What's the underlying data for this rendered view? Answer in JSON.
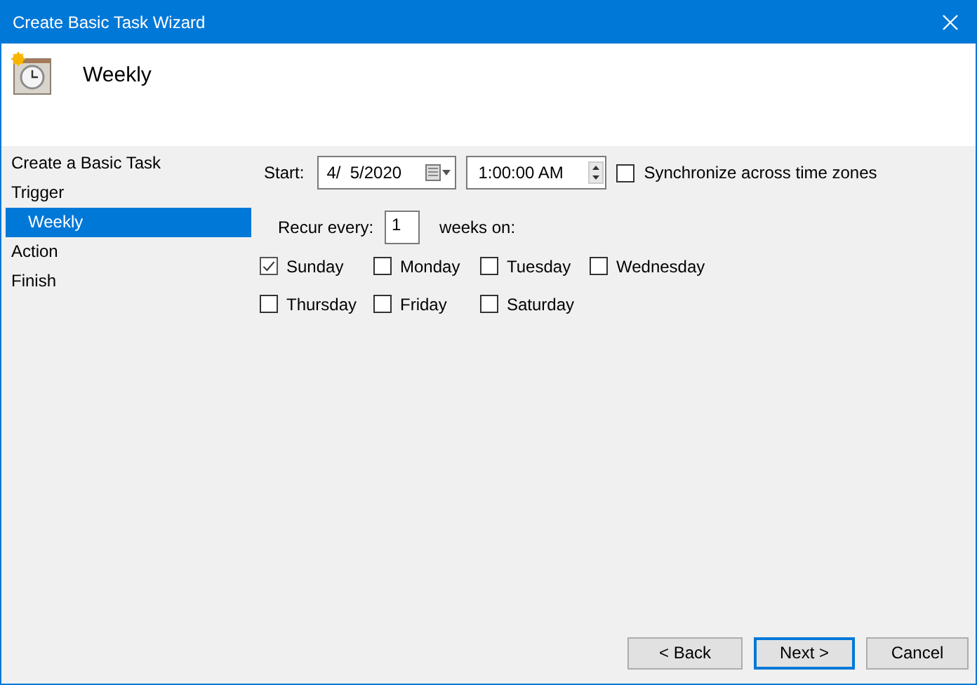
{
  "window": {
    "title": "Create Basic Task Wizard"
  },
  "header": {
    "title": "Weekly"
  },
  "steps": [
    {
      "label": "Create a Basic Task",
      "selected": false
    },
    {
      "label": "Trigger",
      "selected": false,
      "children": [
        {
          "label": "Weekly",
          "selected": true
        }
      ]
    },
    {
      "label": "Action",
      "selected": false
    },
    {
      "label": "Finish",
      "selected": false
    }
  ],
  "schedule": {
    "start_label": "Start:",
    "date": "4/  5/2020",
    "time": "1:00:00 AM",
    "sync": {
      "label": "Synchronize across time zones",
      "checked": false
    },
    "recur_label": "Recur every:",
    "recur_value": "1",
    "recur_suffix": "weeks on:",
    "days": [
      {
        "label": "Sunday",
        "checked": true
      },
      {
        "label": "Monday",
        "checked": false
      },
      {
        "label": "Tuesday",
        "checked": false
      },
      {
        "label": "Wednesday",
        "checked": false
      },
      {
        "label": "Thursday",
        "checked": false
      },
      {
        "label": "Friday",
        "checked": false
      },
      {
        "label": "Saturday",
        "checked": false
      }
    ]
  },
  "buttons": [
    {
      "label": "< Back",
      "default": false
    },
    {
      "label": "Next >",
      "default": true
    },
    {
      "label": "Cancel",
      "default": false
    }
  ]
}
